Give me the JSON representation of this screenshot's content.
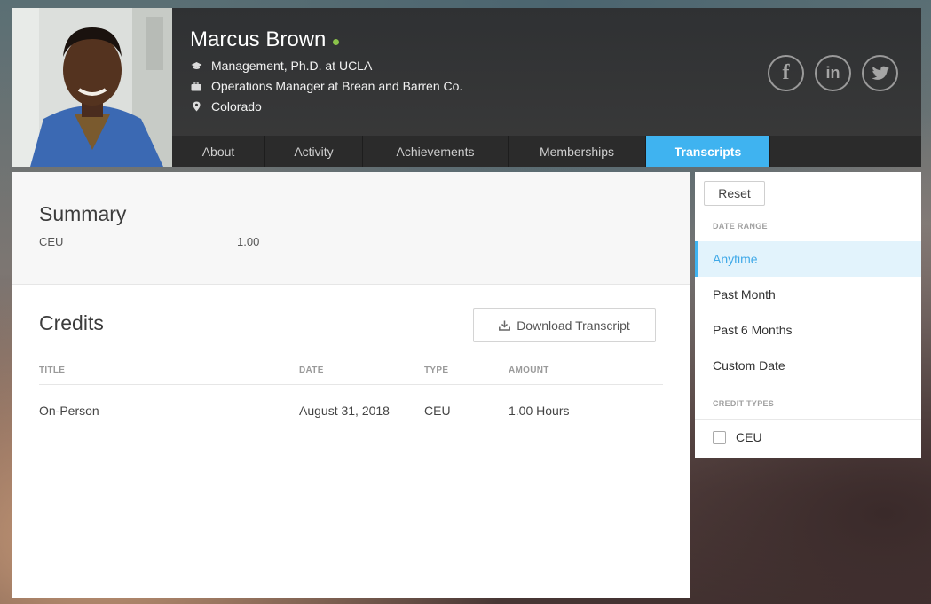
{
  "profile": {
    "name": "Marcus Brown",
    "education": "Management, Ph.D. at UCLA",
    "job": "Operations Manager at Brean and Barren Co.",
    "location": "Colorado",
    "status_color": "#8bc34a"
  },
  "socials": [
    {
      "icon": "facebook-icon",
      "glyph": "f"
    },
    {
      "icon": "linkedin-icon",
      "glyph": "in"
    },
    {
      "icon": "twitter-icon",
      "glyph": "bird"
    }
  ],
  "tabs": [
    {
      "label": "About"
    },
    {
      "label": "Activity"
    },
    {
      "label": "Achievements"
    },
    {
      "label": "Memberships"
    },
    {
      "label": "Transcripts",
      "active": true
    }
  ],
  "summary": {
    "title": "Summary",
    "rows": [
      {
        "label": "CEU",
        "value": "1.00"
      }
    ]
  },
  "credits": {
    "title": "Credits",
    "download_label": "Download Transcript",
    "columns": [
      "TITLE",
      "DATE",
      "TYPE",
      "AMOUNT"
    ],
    "rows": [
      {
        "title": "On-Person",
        "date": "August 31, 2018",
        "type": "CEU",
        "amount": "1.00 Hours"
      }
    ]
  },
  "filter": {
    "reset_label": "Reset",
    "date_range_label": "DATE RANGE",
    "date_ranges": [
      "Anytime",
      "Past Month",
      "Past 6 Months",
      "Custom Date"
    ],
    "selected_range": "Anytime",
    "credit_types_label": "CREDIT TYPES",
    "credit_types": [
      {
        "label": "CEU",
        "checked": false
      }
    ]
  },
  "colors": {
    "accent": "#3fb3f0",
    "header_bg": "#333333"
  }
}
